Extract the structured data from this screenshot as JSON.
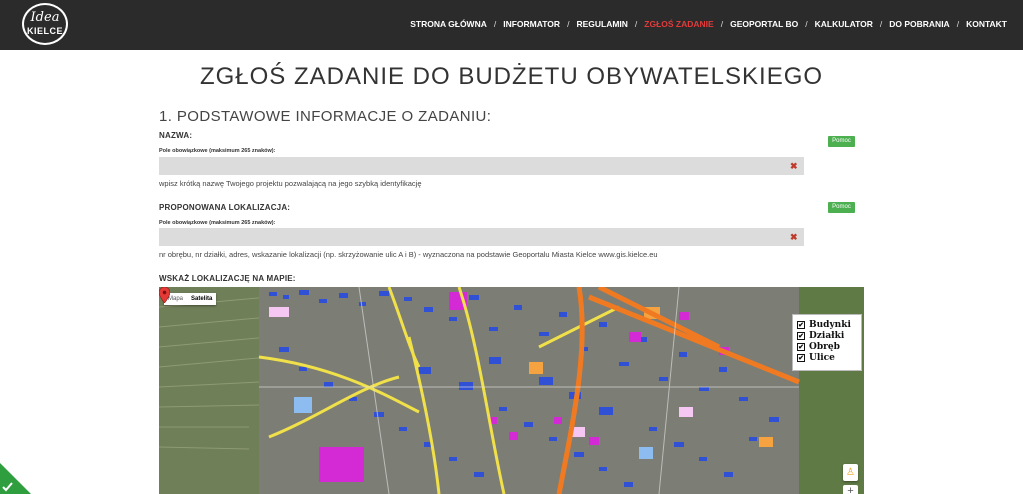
{
  "logo": {
    "line1": "Idea",
    "line2": "KIELCE"
  },
  "nav": [
    {
      "label": "STRONA GŁÓWNA",
      "active": false
    },
    {
      "label": "INFORMATOR",
      "active": false
    },
    {
      "label": "REGULAMIN",
      "active": false
    },
    {
      "label": "ZGŁOŚ ZADANIE",
      "active": true
    },
    {
      "label": "GEOPORTAL BO",
      "active": false
    },
    {
      "label": "KALKULATOR",
      "active": false
    },
    {
      "label": "DO POBRANIA",
      "active": false
    },
    {
      "label": "KONTAKT",
      "active": false
    }
  ],
  "nav_separator": "/",
  "page_title": "ZGŁOŚ ZADANIE DO BUDŻETU OBYWATELSKIEGO",
  "section_title": "1. PODSTAWOWE INFORMACJE O ZADANIU:",
  "fields": {
    "name": {
      "label": "NAZWA:",
      "hint": "Pole obowiązkowe (maksimum 265 znaków):",
      "value": "",
      "help": "Pomoc",
      "description": "wpisz krótką nazwę Twojego projektu pozwalającą na jego szybką identyfikację"
    },
    "location": {
      "label": "PROPONOWANA LOKALIZACJA:",
      "hint": "Pole obowiązkowe (maksimum 265 znaków):",
      "value": "",
      "help": "Pomoc",
      "description": "nr obrębu, nr działki, adres, wskazanie lokalizacji (np. skrzyżowanie ulic A i B) - wyznaczona na podstawie Geoportalu Miasta Kielce www.gis.kielce.eu"
    }
  },
  "map": {
    "label": "WSKAŻ LOKALIZACJĘ NA MAPIE:",
    "type_options": [
      "Mapa",
      "Satelita"
    ],
    "selected_type": "Satelita",
    "layers": [
      {
        "label": "Budynki",
        "checked": true
      },
      {
        "label": "Działki",
        "checked": true
      },
      {
        "label": "Obręb",
        "checked": true
      },
      {
        "label": "Ulice",
        "checked": true
      }
    ],
    "zoom_in_label": "+",
    "colors": {
      "roads": "#f0e04a",
      "main_road": "#f07a22",
      "buildings": "#2b4fd8",
      "special": "#d42ad6"
    }
  },
  "colors": {
    "header_bg": "#2b2b2b",
    "active_nav": "#e23b3b",
    "help_button": "#4caf50",
    "input_bg": "#dcdcdc",
    "clear_icon": "#c0392b"
  }
}
